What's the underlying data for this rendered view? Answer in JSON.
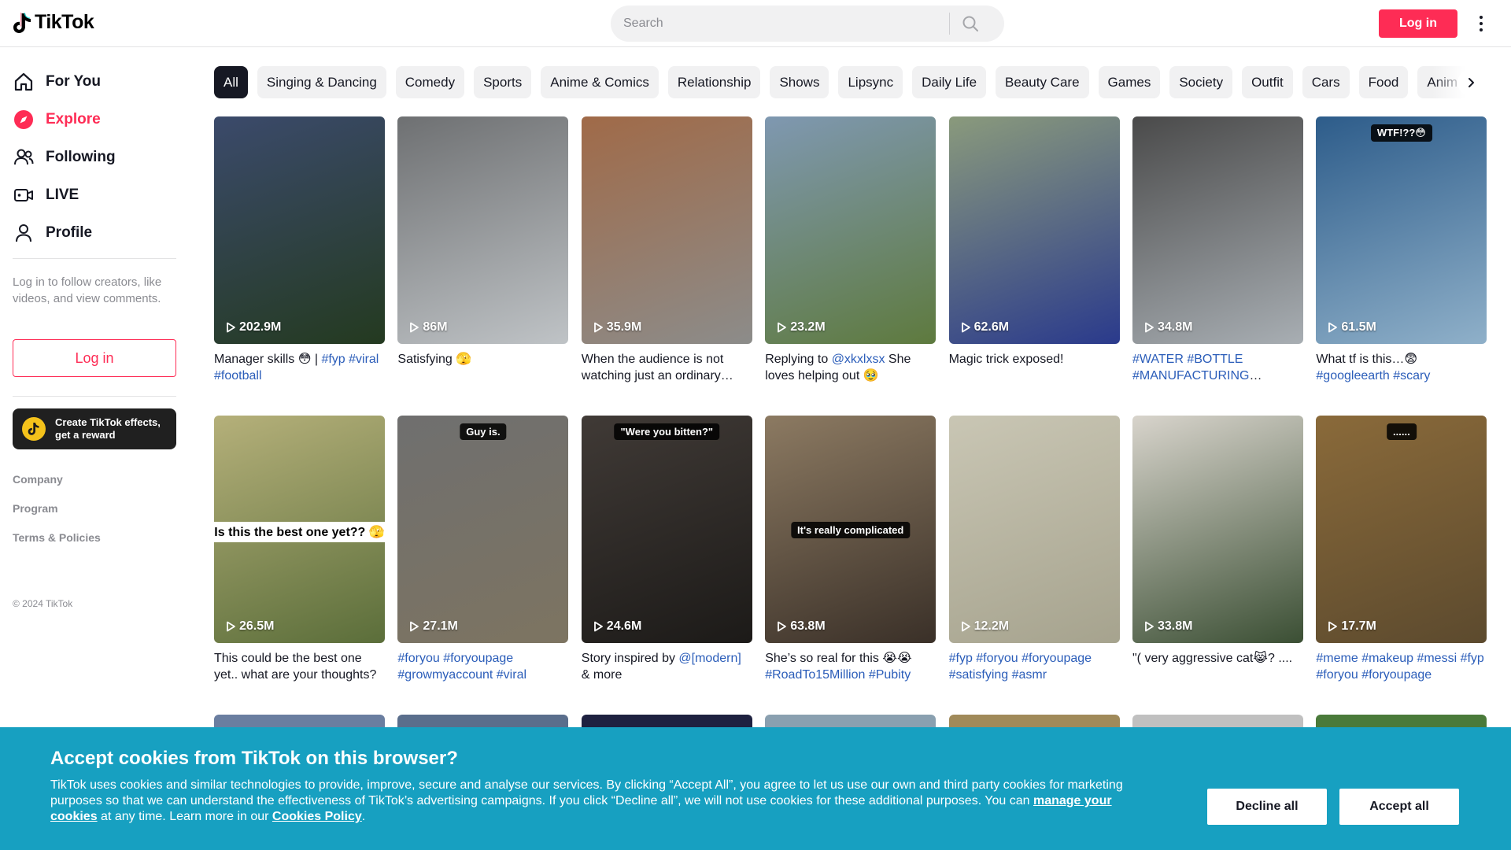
{
  "header": {
    "logo_text": "TikTok",
    "search_placeholder": "Search",
    "login_label": "Log in"
  },
  "sidebar": {
    "nav": [
      {
        "label": "For You",
        "icon": "home-icon"
      },
      {
        "label": "Explore",
        "icon": "compass-icon",
        "active": true
      },
      {
        "label": "Following",
        "icon": "following-icon"
      },
      {
        "label": "LIVE",
        "icon": "live-icon"
      },
      {
        "label": "Profile",
        "icon": "profile-icon"
      }
    ],
    "login_prompt": "Log in to follow creators, like videos, and view comments.",
    "login_button": "Log in",
    "promo_text": "Create TikTok effects, get a reward",
    "footer_links": [
      "Company",
      "Program",
      "Terms & Policies"
    ],
    "copyright": "© 2024 TikTok"
  },
  "categories": [
    "All",
    "Singing & Dancing",
    "Comedy",
    "Sports",
    "Anime & Comics",
    "Relationship",
    "Shows",
    "Lipsync",
    "Daily Life",
    "Beauty Care",
    "Games",
    "Society",
    "Outfit",
    "Cars",
    "Food",
    "Animals"
  ],
  "videos": [
    {
      "views": "202.9M",
      "caption": "Manager skills 😳 | ",
      "tags": "#fyp #viral #football",
      "colors": [
        "#3b4a6b",
        "#243a20"
      ]
    },
    {
      "views": "86M",
      "caption": "Satisfying 🫣",
      "tags": "",
      "colors": [
        "#6e7072",
        "#bfc3c6"
      ]
    },
    {
      "views": "35.9M",
      "caption": "When the audience is not watching just an ordinary street performer",
      "tags": "",
      "colors": [
        "#a06a48",
        "#8c8c8a"
      ]
    },
    {
      "views": "23.2M",
      "caption": "Replying to ",
      "tags": "@xkxlxsx",
      "caption2": " She loves helping out 🥹",
      "colors": [
        "#7f98b1",
        "#5e7a3e"
      ]
    },
    {
      "views": "62.6M",
      "caption": "Magic trick exposed!",
      "tags": "",
      "colors": [
        "#8a9a7c",
        "#2a3a8c"
      ]
    },
    {
      "views": "34.8M",
      "caption": "",
      "tags": "#WATER #BOTTLE #MANUFACTURING #FACTORY",
      "colors": [
        "#4a4a4a",
        "#a8aeb3"
      ]
    },
    {
      "views": "61.5M",
      "caption": "What tf is this…😨 ",
      "tags": "#googleearth #scary",
      "overlay": "WTF!??😳",
      "colors": [
        "#2d5c8a",
        "#8fb0c9"
      ]
    },
    {
      "views": "26.5M",
      "caption": "This could be the best one yet.. what are your thoughts?",
      "tags": "",
      "overlay": "Is this the best one yet?? 🫣",
      "colors": [
        "#b5b07a",
        "#5b6e3a"
      ]
    },
    {
      "views": "27.1M",
      "caption": "",
      "tags": "#foryou #foryoupage #growmyaccount #viral",
      "overlay": "Guy is.",
      "colors": [
        "#6f6f6f",
        "#7d7461"
      ]
    },
    {
      "views": "24.6M",
      "caption": "Story inspired by ",
      "tags": "@[modern]",
      "caption2": " & more",
      "overlay": "\"Were you bitten?\"",
      "colors": [
        "#403a36",
        "#1c1a18"
      ]
    },
    {
      "views": "63.8M",
      "caption": "She’s so real for this 😭😭 ",
      "tags": "#RoadTo15Million #Pubity",
      "overlay": "It's really complicated",
      "colors": [
        "#8c7a62",
        "#3a3028"
      ]
    },
    {
      "views": "12.2M",
      "caption": "",
      "tags": "#fyp #foryou #foryoupage #satisfying #asmr",
      "colors": [
        "#c9c6b4",
        "#a6a38e"
      ]
    },
    {
      "views": "33.8M",
      "caption": "\"( very aggressive cat😹? ....",
      "tags": "",
      "colors": [
        "#d8d4cc",
        "#3b4f34"
      ]
    },
    {
      "views": "17.7M",
      "caption": "",
      "tags": "#meme #makeup #messi #fyp #foryou #foryoupage",
      "overlay": "......",
      "colors": [
        "#8a6a3a",
        "#5c4a2e"
      ]
    }
  ],
  "cookie": {
    "title": "Accept cookies from TikTok on this browser?",
    "body_1": "TikTok uses cookies and similar technologies to provide, improve, secure and analyse our services. By clicking “Accept All”, you agree to let us use our own and third party cookies for marketing purposes so that we can understand the effectiveness of TikTok’s advertising campaigns. If you click “Decline all”, we will not use cookies for these additional purposes. You can ",
    "manage_link": "manage your cookies",
    "body_2": " at any time. Learn more in our ",
    "policy_link": "Cookies Policy",
    "body_3": ".",
    "decline_label": "Decline all",
    "accept_label": "Accept all"
  },
  "colors": {
    "brand": "#fe2c55",
    "cookie_bg": "#17a0c1",
    "hashtag": "#2b5db9"
  }
}
